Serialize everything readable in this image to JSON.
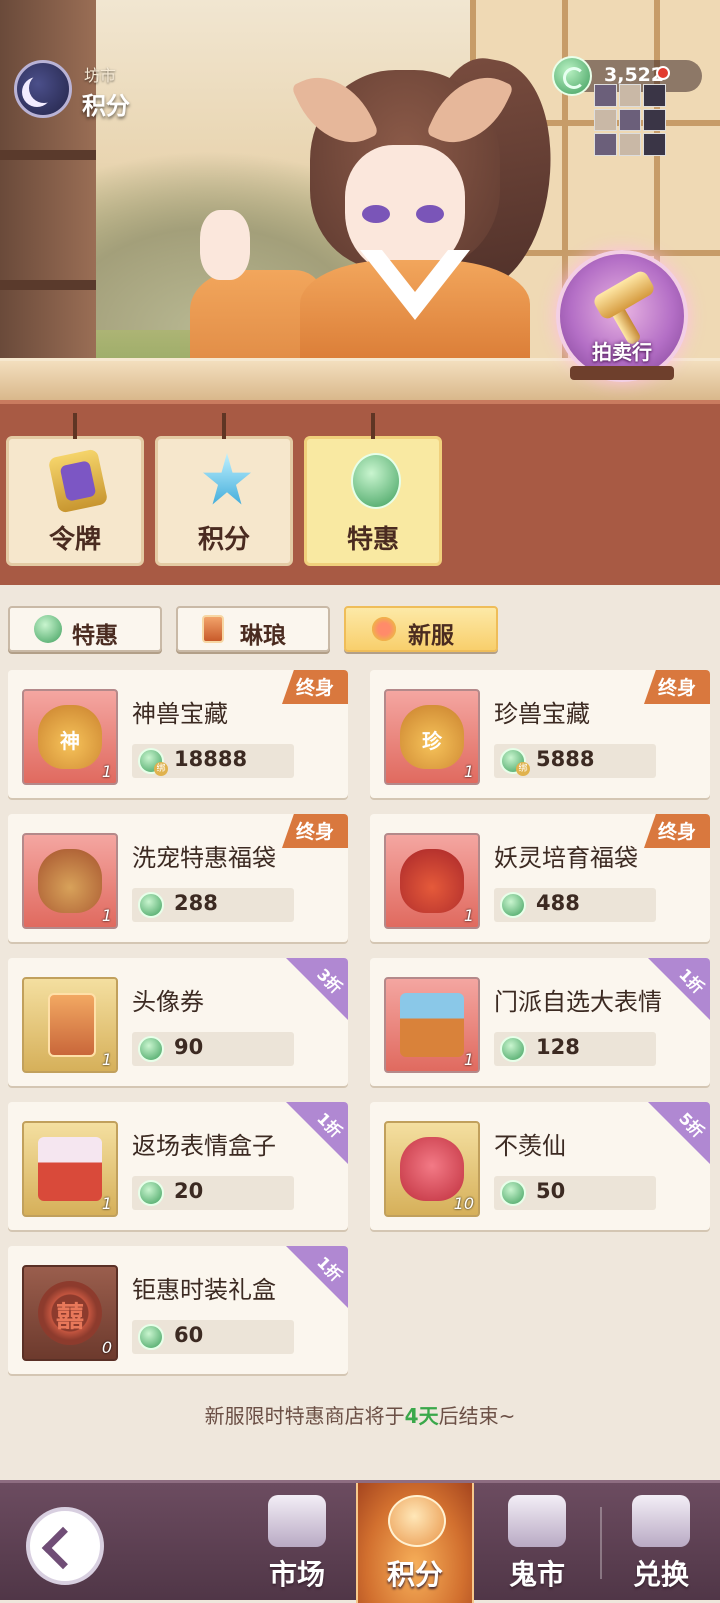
{
  "header": {
    "location_sub": "坊市",
    "location_main": "积分",
    "currency_amount": "3,522",
    "auction_label": "拍卖行"
  },
  "categories": [
    {
      "label": "令牌",
      "icon": "token-icon",
      "active": false
    },
    {
      "label": "积分",
      "icon": "star-icon",
      "active": false
    },
    {
      "label": "特惠",
      "icon": "jade-coin-icon",
      "active": true
    }
  ],
  "subtabs": [
    {
      "label": "特惠",
      "icon": "jade-coin-icon",
      "active": false
    },
    {
      "label": "琳琅",
      "icon": "card-icon",
      "active": false
    },
    {
      "label": "新服",
      "icon": "flower-icon",
      "active": true
    }
  ],
  "items": [
    {
      "name": "神兽宝藏",
      "price": "18888",
      "qty": "1",
      "tag": "终身",
      "tag_type": "ribbon",
      "icon_glyph": "神",
      "bound": true
    },
    {
      "name": "珍兽宝藏",
      "price": "5888",
      "qty": "1",
      "tag": "终身",
      "tag_type": "ribbon",
      "icon_glyph": "珍",
      "bound": true
    },
    {
      "name": "洗宠特惠福袋",
      "price": "288",
      "qty": "1",
      "tag": "终身",
      "tag_type": "ribbon",
      "icon_glyph": "",
      "bound": false
    },
    {
      "name": "妖灵培育福袋",
      "price": "488",
      "qty": "1",
      "tag": "终身",
      "tag_type": "ribbon",
      "icon_glyph": "",
      "bound": false
    },
    {
      "name": "头像券",
      "price": "90",
      "qty": "1",
      "tag": "3折",
      "tag_type": "corner",
      "icon_glyph": "",
      "bound": false
    },
    {
      "name": "门派自选大表情",
      "price": "128",
      "qty": "1",
      "tag": "1折",
      "tag_type": "corner",
      "icon_glyph": "",
      "bound": false
    },
    {
      "name": "返场表情盒子",
      "price": "20",
      "qty": "1",
      "tag": "1折",
      "tag_type": "corner",
      "icon_glyph": "",
      "bound": false
    },
    {
      "name": "不羡仙",
      "price": "50",
      "qty": "10",
      "tag": "5折",
      "tag_type": "corner",
      "icon_glyph": "",
      "bound": false
    },
    {
      "name": "钜惠时装礼盒",
      "price": "60",
      "qty": "0",
      "tag": "1折",
      "tag_type": "corner",
      "icon_glyph": "囍",
      "bound": false
    }
  ],
  "notice": {
    "before": "新服限时特惠商店将于",
    "highlight": "4天",
    "after": "后结束~"
  },
  "nav": [
    {
      "label": "市场",
      "active": false
    },
    {
      "label": "积分",
      "active": true
    },
    {
      "label": "鬼市",
      "active": false
    },
    {
      "label": "兑换",
      "active": false
    }
  ],
  "colors": {
    "accent_orange": "#d9783e",
    "discount_purple": "#b088d2",
    "highlight_green": "#3aa84a",
    "panel_brown": "#a85a44"
  }
}
